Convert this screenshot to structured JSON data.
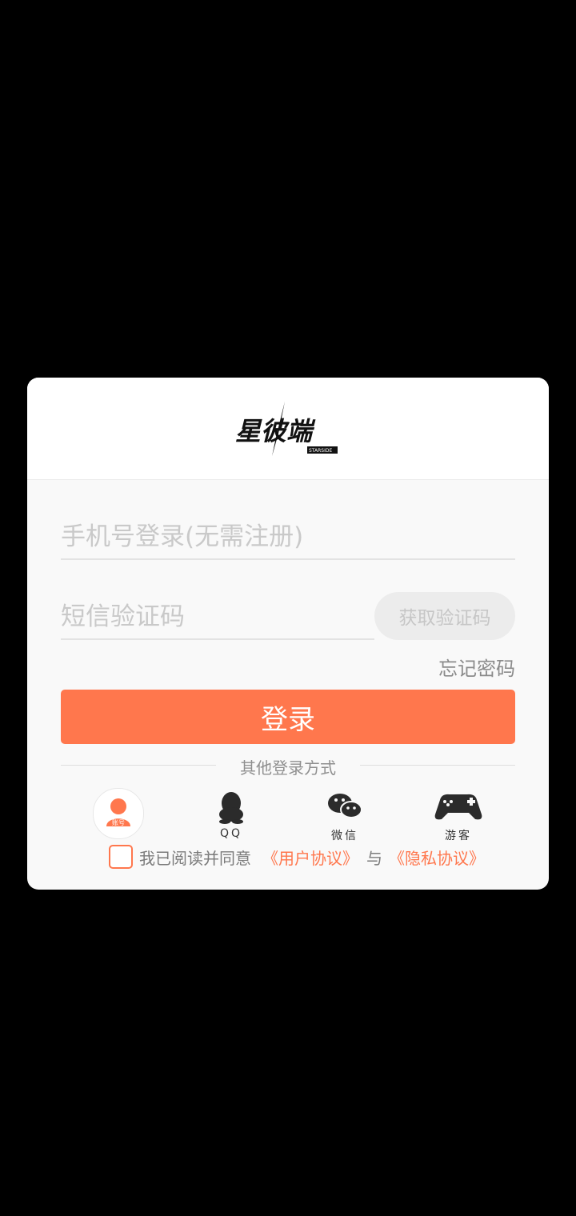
{
  "logo": {
    "main_text": "星彼端",
    "sub_text": "STARSIDE"
  },
  "login": {
    "phone_placeholder": "手机号登录(无需注册)",
    "code_placeholder": "短信验证码",
    "get_code_label": "获取验证码",
    "forgot_label": "忘记密码",
    "login_button_label": "登录",
    "other_methods_label": "其他登录方式"
  },
  "methods": [
    {
      "name": "account",
      "label": "账号",
      "icon": "user-icon"
    },
    {
      "name": "qq",
      "label": "QQ",
      "icon": "qq-penguin-icon"
    },
    {
      "name": "wechat",
      "label": "微信",
      "icon": "wechat-icon"
    },
    {
      "name": "guest",
      "label": "游客",
      "icon": "gamepad-icon"
    }
  ],
  "agreement": {
    "prefix": "我已阅读并同意",
    "user_agreement": "《用户协议》",
    "joiner": "与",
    "privacy": "《隐私协议》"
  },
  "colors": {
    "accent": "#ff774d",
    "background": "#000000",
    "panel": "#f9f9f9"
  }
}
